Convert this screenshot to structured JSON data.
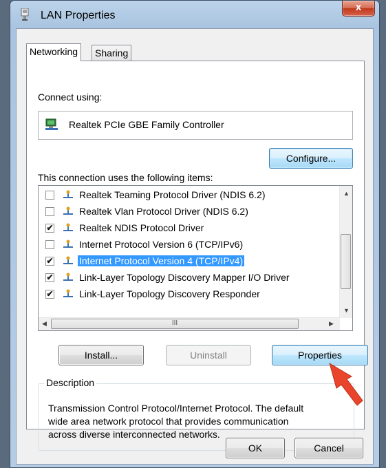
{
  "window": {
    "title": "LAN Properties",
    "close_label": "x"
  },
  "tabs": [
    {
      "label": "Networking"
    },
    {
      "label": "Sharing"
    }
  ],
  "connect_using_label": "Connect using:",
  "adapter_name": "Realtek PCIe GBE Family Controller",
  "configure_label": "Configure...",
  "items_label": "This connection uses the following items:",
  "items": [
    {
      "label": "Realtek Teaming Protocol Driver (NDIS 6.2)",
      "checked": ""
    },
    {
      "label": "Realtek Vlan Protocol Driver (NDIS 6.2)",
      "checked": ""
    },
    {
      "label": "Realtek NDIS Protocol Driver",
      "checked": "✔"
    },
    {
      "label": "Internet Protocol Version 6 (TCP/IPv6)",
      "checked": ""
    },
    {
      "label": "Internet Protocol Version 4 (TCP/IPv4)",
      "checked": "✔"
    },
    {
      "label": "Link-Layer Topology Discovery Mapper I/O Driver",
      "checked": "✔"
    },
    {
      "label": "Link-Layer Topology Discovery Responder",
      "checked": "✔"
    }
  ],
  "hscroll_grip": "III",
  "buttons": {
    "install": "Install...",
    "uninstall": "Uninstall",
    "properties": "Properties",
    "ok": "OK",
    "cancel": "Cancel"
  },
  "description": {
    "legend": "Description",
    "text": "Transmission Control Protocol/Internet Protocol. The default\nwide area network protocol that provides communication\nacross diverse interconnected networks."
  },
  "colors": {
    "selection": "#3399ff",
    "pointer": "#e8452c"
  }
}
